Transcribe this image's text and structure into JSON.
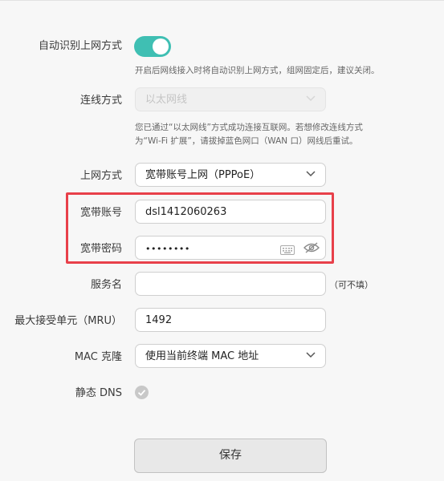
{
  "auto_detect": {
    "label": "自动识别上网方式",
    "enabled": true,
    "hint": "开启后网线接入时将自动识别上网方式，组网固定后，建议关闭。"
  },
  "connection_type": {
    "label": "连线方式",
    "value": "以太网线",
    "hint_line1": "您已通过“以太网线”方式成功连接互联网。若想修改连线方式",
    "hint_line2": "为“Wi-Fi 扩展”，请拔掉蓝色网口（WAN 口）网线后重试。"
  },
  "internet_mode": {
    "label": "上网方式",
    "value": "宽带账号上网（PPPoE）"
  },
  "broadband_account": {
    "label": "宽带账号",
    "value": "dsl1412060263"
  },
  "broadband_password": {
    "label": "宽带密码",
    "value": "••••••••"
  },
  "service_name": {
    "label": "服务名",
    "value": "",
    "note": "（可不填）"
  },
  "mru": {
    "label": "最大接受单元（MRU）",
    "value": "1492"
  },
  "mac_clone": {
    "label": "MAC 克隆",
    "value": "使用当前终端 MAC 地址"
  },
  "static_dns": {
    "label": "静态 DNS",
    "checked": false
  },
  "save_button": {
    "label": "保存"
  },
  "colors": {
    "accent": "#3fbfb3",
    "highlight": "#e8404a"
  },
  "icons": [
    "chevron-down-icon",
    "keyboard-icon",
    "eye-icon",
    "check-icon"
  ]
}
